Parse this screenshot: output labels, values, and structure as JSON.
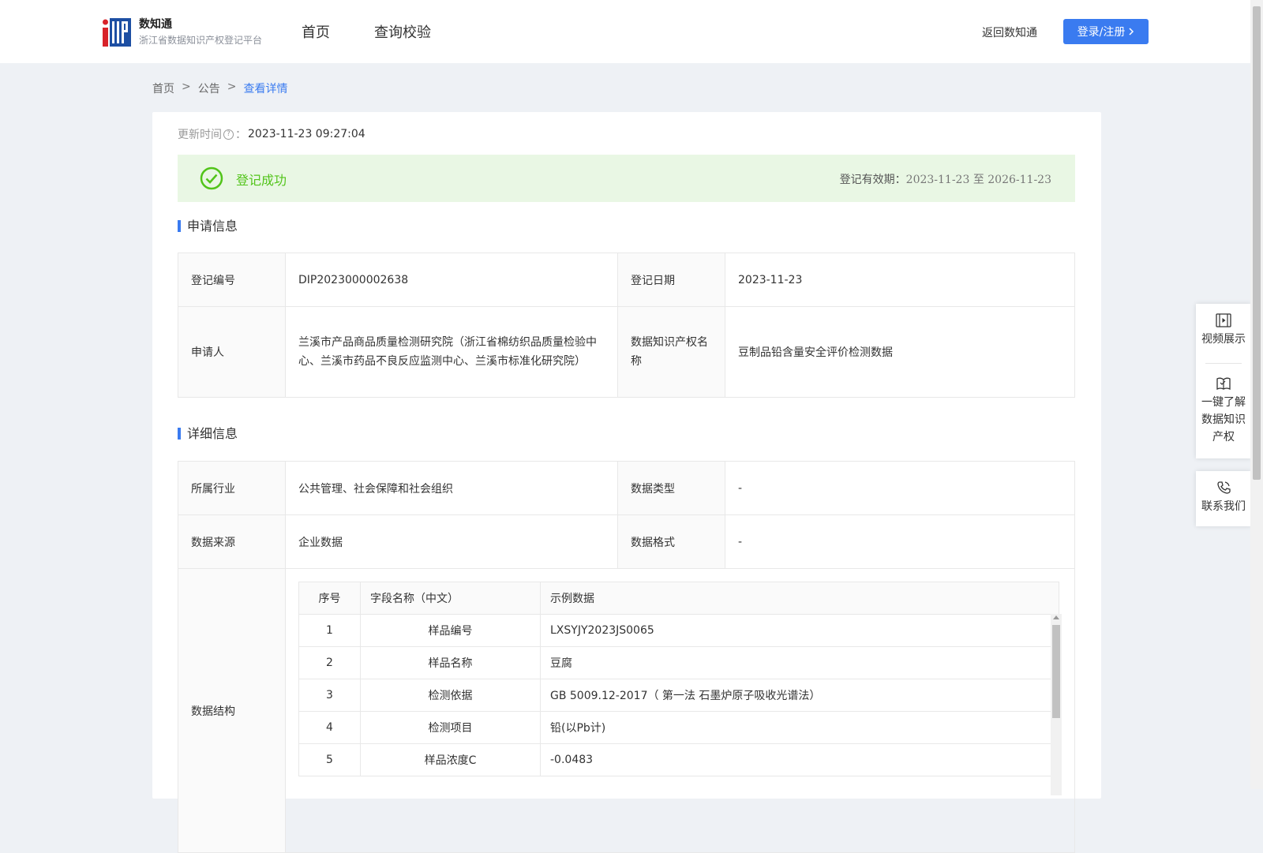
{
  "header": {
    "logo_title": "数知通",
    "logo_subtitle": "浙江省数据知识产权登记平台",
    "nav": [
      "首页",
      "查询校验"
    ],
    "back_link": "返回数知通",
    "login_button": "登录/注册"
  },
  "breadcrumb": [
    "首页",
    "公告",
    "查看详情"
  ],
  "update": {
    "label": "更新时间",
    "colon": "：",
    "value": "2023-11-23 09:27:04"
  },
  "status": {
    "text": "登记成功",
    "validity_label": "登记有效期：",
    "validity_dates": "2023-11-23 至 2026-11-23",
    "color": "#52c41a"
  },
  "application_info": {
    "title": "申请信息",
    "reg_no_label": "登记编号",
    "reg_no": "DIP2023000002638",
    "reg_date_label": "登记日期",
    "reg_date": "2023-11-23",
    "applicant_label": "申请人",
    "applicant": "兰溪市产品商品质量检测研究院（浙江省棉纺织品质量检验中心、兰溪市药品不良反应监测中心、兰溪市标准化研究院）",
    "ip_name_label": "数据知识产权名称",
    "ip_name": "豆制品铅含量安全评价检测数据"
  },
  "detail_info": {
    "title": "详细信息",
    "industry_label": "所属行业",
    "industry": "公共管理、社会保障和社会组织",
    "data_type_label": "数据类型",
    "data_type": "-",
    "source_label": "数据来源",
    "source": "企业数据",
    "format_label": "数据格式",
    "format": "-",
    "structure_label": "数据结构",
    "fields_headers": [
      "序号",
      "字段名称（中文）",
      "示例数据"
    ],
    "fields": [
      {
        "no": "1",
        "name": "样品编号",
        "example": "LXSYJY2023JS0065"
      },
      {
        "no": "2",
        "name": "样品名称",
        "example": "豆腐"
      },
      {
        "no": "3",
        "name": "检测依据",
        "example": "GB 5009.12-2017（ 第一法 石墨炉原子吸收光谱法）"
      },
      {
        "no": "4",
        "name": "检测项目",
        "example": "铅(以Pb计)"
      },
      {
        "no": "5",
        "name": "样品浓度C",
        "example": "-0.0483"
      }
    ]
  },
  "float_panel": {
    "video": "视频展示",
    "learn": "一键了解数据知识产权",
    "contact": "联系我们"
  },
  "colors": {
    "accent": "#3a7bf0",
    "success_bg": "#e9f7e4"
  },
  "icons": [
    "logo-icon",
    "chevron-right-icon",
    "question-circle-icon",
    "check-circle-icon",
    "video-icon",
    "book-icon",
    "phone-icon"
  ]
}
